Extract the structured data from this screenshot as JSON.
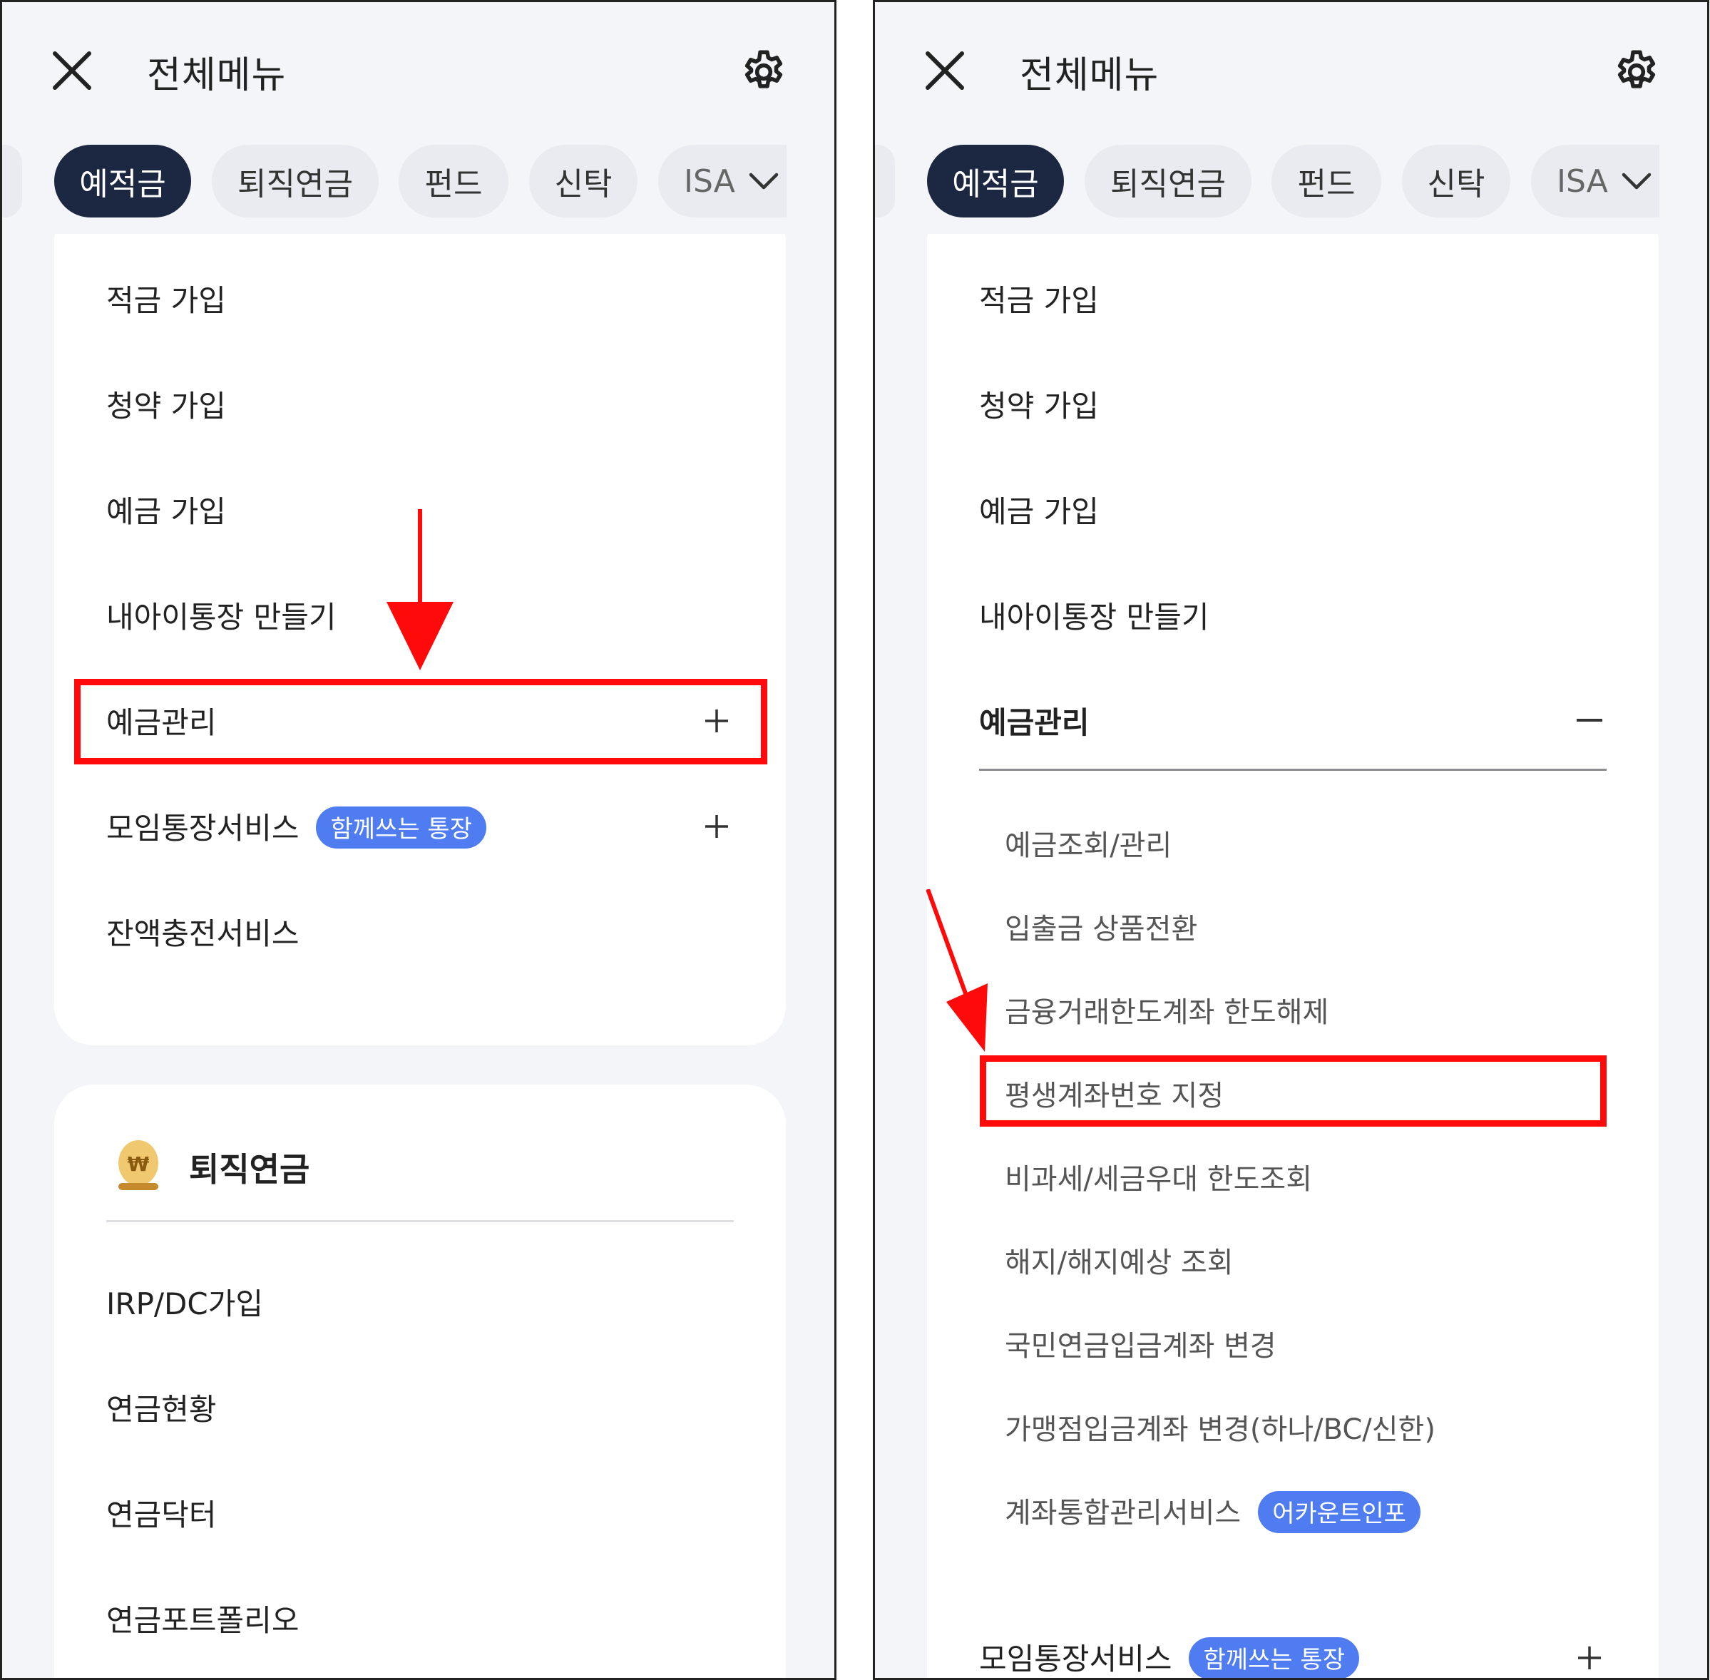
{
  "header": {
    "title": "전체메뉴"
  },
  "tabs": {
    "items": [
      "예적금",
      "퇴직연금",
      "펀드",
      "신탁",
      "ISA"
    ]
  },
  "left": {
    "deposit_items": [
      "적금 가입",
      "청약 가입",
      "예금 가입",
      "내아이통장 만들기",
      "예금관리",
      "모임통장서비스",
      "잔액충전서비스"
    ],
    "moim_badge": "함께쓰는 통장",
    "pension": {
      "title": "퇴직연금",
      "items": [
        "IRP/DC가입",
        "연금현황",
        "연금닥터",
        "연금포트폴리오"
      ]
    }
  },
  "right": {
    "deposit_items": [
      "적금 가입",
      "청약 가입",
      "예금 가입",
      "내아이통장 만들기"
    ],
    "expanded": {
      "title": "예금관리",
      "sub_items": [
        "예금조회/관리",
        "입출금 상품전환",
        "금융거래한도계좌 한도해제",
        "평생계좌번호 지정",
        "비과세/세금우대 한도조회",
        "해지/해지예상 조회",
        "국민연금입금계좌 변경",
        "가맹점입금계좌 변경(하나/BC/신한)",
        "계좌통합관리서비스"
      ],
      "account_badge": "어카운트인포"
    },
    "moim": "모임통장서비스",
    "moim_badge": "함께쓰는 통장"
  },
  "colors": {
    "active_tab": "#1c2741",
    "badge": "#4f7cf1",
    "highlight": "#ff0a0a"
  },
  "icons": [
    "close-icon",
    "gear-icon",
    "chevron-down-icon",
    "plus-icon",
    "minus-icon",
    "egg-coin-icon",
    "red-arrow"
  ]
}
